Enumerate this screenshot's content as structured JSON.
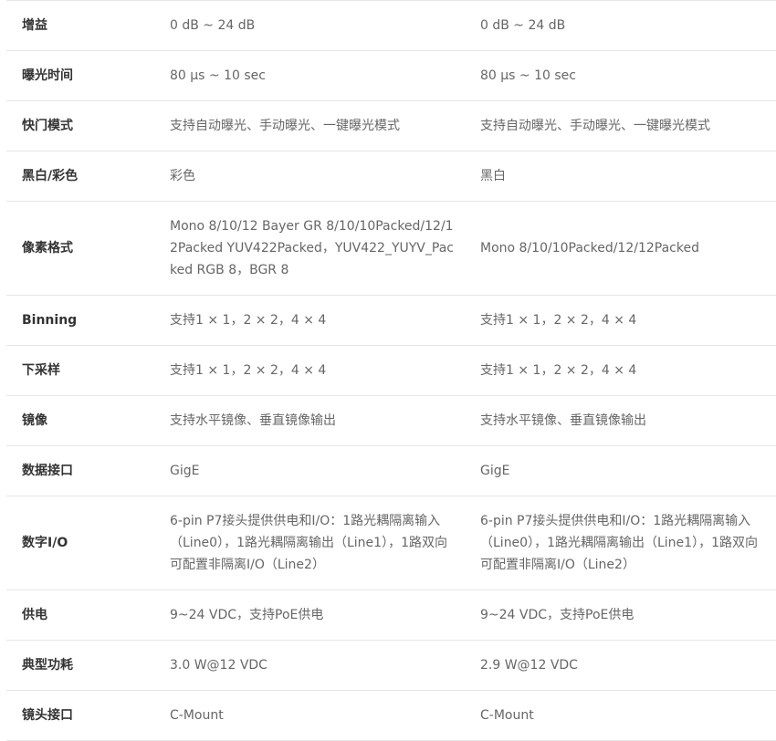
{
  "table": {
    "rows": [
      {
        "label": "增益",
        "a": "0 dB ~ 24 dB",
        "b": "0 dB ~ 24 dB"
      },
      {
        "label": "曝光时间",
        "a": "80 μs ~ 10 sec",
        "b": "80 μs ~ 10 sec"
      },
      {
        "label": "快门模式",
        "a": "支持自动曝光、手动曝光、一键曝光模式",
        "b": "支持自动曝光、手动曝光、一键曝光模式"
      },
      {
        "label": "黑白/彩色",
        "a": "彩色",
        "b": "黑白"
      },
      {
        "label": "像素格式",
        "a": "Mono 8/10/12 Bayer GR 8/10/10Packed/12/12Packed YUV422Packed，YUV422_YUYV_Packed RGB 8，BGR 8",
        "b": "Mono 8/10/10Packed/12/12Packed"
      },
      {
        "label": "Binning",
        "a": "支持1 × 1，2 × 2，4 × 4",
        "b": "支持1 × 1，2 × 2，4 × 4"
      },
      {
        "label": "下采样",
        "a": "支持1 × 1，2 × 2，4 × 4",
        "b": "支持1 × 1，2 × 2，4 × 4"
      },
      {
        "label": "镜像",
        "a": "支持水平镜像、垂直镜像输出",
        "b": "支持水平镜像、垂直镜像输出"
      },
      {
        "label": "数据接口",
        "a": "GigE",
        "b": "GigE"
      },
      {
        "label": "数字I/O",
        "a": "6-pin P7接头提供供电和I/O：1路光耦隔离输入（Line0），1路光耦隔离输出（Line1），1路双向可配置非隔离I/O（Line2）",
        "b": "6-pin P7接头提供供电和I/O：1路光耦隔离输入（Line0），1路光耦隔离输出（Line1），1路双向可配置非隔离I/O（Line2）"
      },
      {
        "label": "供电",
        "a": "9~24 VDC，支持PoE供电",
        "b": "9~24 VDC，支持PoE供电"
      },
      {
        "label": "典型功耗",
        "a": "3.0 W@12 VDC",
        "b": "2.9 W@12 VDC"
      },
      {
        "label": "镜头接口",
        "a": "C-Mount",
        "b": "C-Mount"
      }
    ]
  }
}
